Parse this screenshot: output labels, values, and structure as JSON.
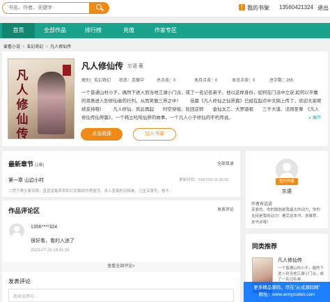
{
  "header": {
    "search_placeholder": "书名、作者、关键字",
    "my_shelf": "我的书架",
    "user_phone": "13560421324",
    "logout": "退出"
  },
  "nav": {
    "items": [
      {
        "label": "首页"
      },
      {
        "label": "全部作品"
      },
      {
        "label": "排行榜"
      },
      {
        "label": "充值"
      },
      {
        "label": "作家专区"
      }
    ]
  },
  "breadcrumb": {
    "items": [
      "爱看小说",
      "玄幻奇幻",
      "凡人修仙传"
    ],
    "separator": ">"
  },
  "book": {
    "cover_title": "凡人修仙传",
    "title": "凡人修仙传",
    "author": "忘语 著",
    "meta": [
      "类别：玄幻奇幻",
      "状态：连载中",
      "总点击：0",
      "本月点击：0",
      "本日点击：0",
      "总字数：265"
    ],
    "summary": "一个普通山村小子，偶然下进入到当地江湖小门派，成了一名记名弟子。他以这样身份，如何在门派中立足,如何以平庸的资质进入到修仙者的行列，从而笑傲三界之中！　　佳篇《凡人修仙之仙界篇》已经在起点中文网上传了，欢迎大家继续支持哦！　　凡人修仙、风云再起　　时空穿梭、轮回逆转　　金仙太乙、大罗道祖　　三千大道、法则至尊　《凡人修仙传仙界篇》，一个韩立叱咤仙界的故事，一个凡人小子修仙的不朽传说。",
    "expand_label": "∨ 展开",
    "read_button": "点击阅读",
    "shelf_button": "加入书架"
  },
  "latest_chapter": {
    "title": "最新章节",
    "count": "(1章)",
    "all_link": "全部目录",
    "chapter_name": "第一章 山边小村",
    "chapter_time": "更新时间：23/07/20 11:30:55",
    "snippet": "二愣子睁大着双眼，直直望着茅草和烂泥糊成的黑屋顶，身上盖着的旧棉被，已呈深黄色，看不..."
  },
  "comments": {
    "title": "作品评论区",
    "post_link": "发表评论",
    "items": [
      {
        "user": "1356****324",
        "text": "很好看，看的入迷了",
        "time": "2023-07-20 14:41:35"
      }
    ],
    "more_label": "查看全部评论>",
    "post_title": "发表评论",
    "input_placeholder": "我来说两句..."
  },
  "author_panel": {
    "badge": "签约作家",
    "name": "忘语",
    "words_title": "作者有话说",
    "words": "亲爱的，你的鼓励是我最大的动力，你的支持是我的动力！看完这本书，求推荐，求书评哦！"
  },
  "recommend": {
    "title": "同类推荐",
    "items": [
      {
        "name": "凡人修仙传",
        "desc": "一个普通山村小子，偶然下进入到当地江湖小门派，成了一名记名弟..."
      }
    ]
  },
  "watermark": {
    "line1": "更多精品源码，尽在\"从戎源码网\"",
    "line2": "网址：www.armycodes.com"
  },
  "colors": {
    "accent_orange": "#f08a17",
    "nav_teal": "#1aa28c",
    "watermark_blue": "#006eff"
  }
}
